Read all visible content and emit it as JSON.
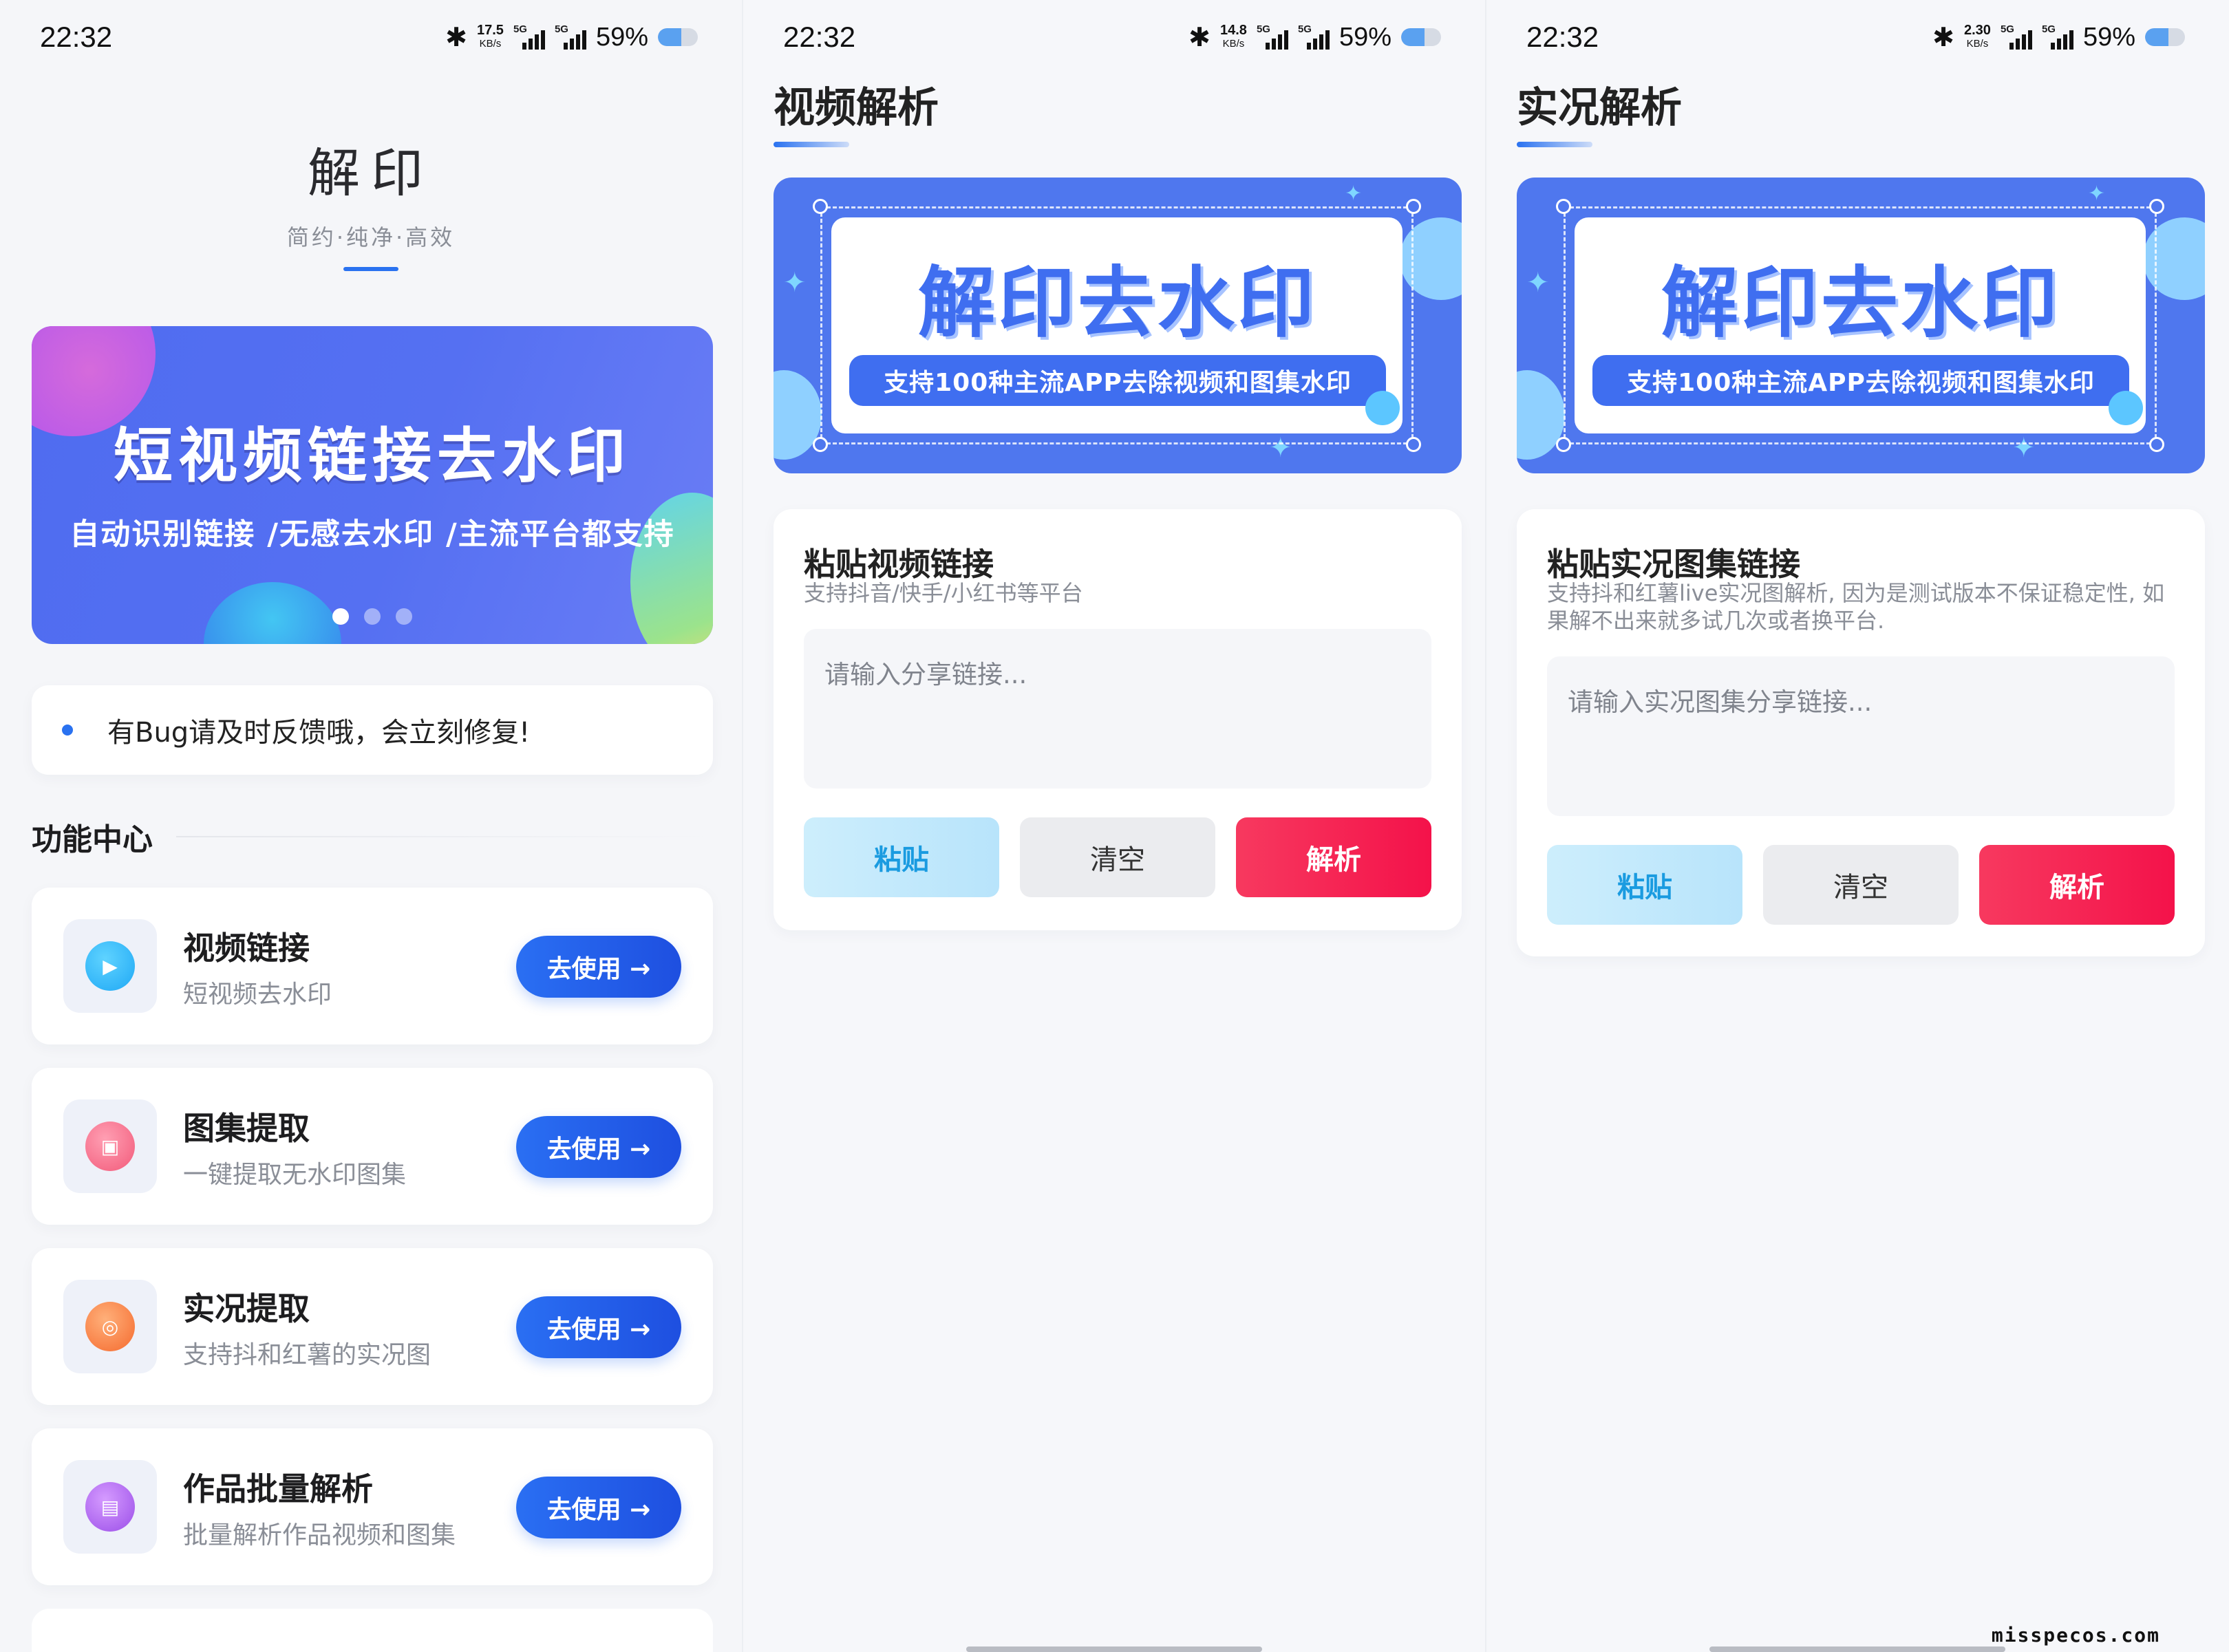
{
  "status_bars": [
    {
      "time": "22:32",
      "speed": "17.5",
      "speed_unit": "KB/s",
      "sim1": "5G",
      "sim2": "5G",
      "battery": "59%"
    },
    {
      "time": "22:32",
      "speed": "14.8",
      "speed_unit": "KB/s",
      "sim1": "5G",
      "sim2": "5G",
      "battery": "59%"
    },
    {
      "time": "22:32",
      "speed": "2.30",
      "speed_unit": "KB/s",
      "sim1": "5G",
      "sim2": "5G",
      "battery": "59%"
    }
  ],
  "home": {
    "app_name": "解印",
    "slogan": "简约·纯净·高效",
    "banner": {
      "title": "短视频链接去水印",
      "subtitle": "自动识别链接 /无感去水印 /主流平台都支持",
      "page_count": 3,
      "active_page": 1
    },
    "notice": "有Bug请及时反馈哦，会立刻修复!",
    "section_title": "功能中心",
    "features": [
      {
        "title": "视频链接",
        "subtitle": "短视频去水印",
        "button": "去使用 →",
        "icon": "play-icon",
        "color": "#1fa8f5"
      },
      {
        "title": "图集提取",
        "subtitle": "一键提取无水印图集",
        "button": "去使用 →",
        "icon": "image-icon",
        "color": "#f25a7a"
      },
      {
        "title": "实况提取",
        "subtitle": "支持抖和红薯的实况图",
        "button": "去使用 →",
        "icon": "live-icon",
        "color": "#f56a2e"
      },
      {
        "title": "作品批量解析",
        "subtitle": "批量解析作品视频和图集",
        "button": "去使用 →",
        "icon": "film-icon",
        "color": "#9b4ee8"
      }
    ]
  },
  "video_page": {
    "title": "视频解析",
    "banner_title": "解印去水印",
    "banner_pill": "支持100种主流APP去除视频和图集水印",
    "label": "粘贴视频链接",
    "hint": "支持抖音/快手/小红书等平台",
    "placeholder": "请输入分享链接...",
    "paste": "粘贴",
    "clear": "清空",
    "parse": "解析"
  },
  "live_page": {
    "title": "实况解析",
    "banner_title": "解印去水印",
    "banner_pill": "支持100种主流APP去除视频和图集水印",
    "label": "粘贴实况图集链接",
    "hint": "支持抖和红薯live实况图解析, 因为是测试版本不保证稳定性, 如果解不出来就多试几次或者换平台.",
    "placeholder": "请输入实况图集分享链接...",
    "paste": "粘贴",
    "clear": "清空",
    "parse": "解析"
  },
  "watermark": "misspecos.com"
}
